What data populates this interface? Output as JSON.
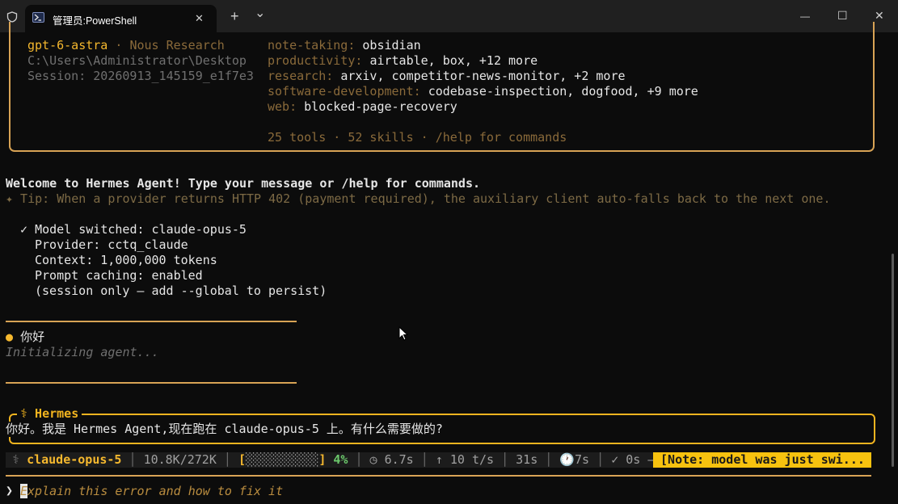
{
  "window": {
    "tab_title": "管理员:PowerShell",
    "tab_close": "✕",
    "new_tab": "+",
    "dropdown": "⌄",
    "minimize": "—",
    "maximize": "☐",
    "close": "✕"
  },
  "banner": {
    "model": "gpt-6-astra",
    "model_sep": " · ",
    "provider": "Nous Research",
    "cwd": "C:\\Users\\Administrator\\Desktop",
    "session": "Session: 20260913_145159_e1f7e3",
    "skills": [
      {
        "category": "note-taking:",
        "value": "obsidian"
      },
      {
        "category": "productivity:",
        "value": "airtable, box, +12 more"
      },
      {
        "category": "research:",
        "value": "arxiv, competitor-news-monitor, +2 more"
      },
      {
        "category": "software-development:",
        "value": "codebase-inspection, dogfood, +9 more"
      },
      {
        "category": "web:",
        "value": "blocked-page-recovery"
      }
    ],
    "summary": "25 tools · 52 skills · /help for commands"
  },
  "welcome": "Welcome to Hermes Agent! Type your message or /help for commands.",
  "tip": "✦ Tip: When a provider returns HTTP 402 (payment required), the auxiliary client auto-falls back to the next one.",
  "model_switch": {
    "check": "✓",
    "lines": [
      "Model switched: claude-opus-5",
      "Provider: cctq_claude",
      "Context: 1,000,000 tokens",
      "Prompt caching: enabled",
      "(session only — add --global to persist)"
    ]
  },
  "user_message": {
    "bullet": "●",
    "text": "你好",
    "status": "Initializing agent..."
  },
  "hermes": {
    "title": "⚕ Hermes",
    "reply": "你好。我是 Hermes Agent,现在跑在 claude-opus-5 上。有什么需要做的?"
  },
  "statusbar": {
    "icon": "⚕",
    "model": "claude-opus-5",
    "tokens": "10.8K/272K",
    "ctx_bar_open": "[",
    "ctx_bar_fill": "░░░░░░░░░░",
    "ctx_bar_close": "]",
    "ctx_pct": "4%",
    "latency": "◷ 6.7s",
    "speed": "↑ 10 t/s",
    "elapsed": "31s",
    "tool_time": "🕐7s",
    "check_time": "✓ 0s",
    "dash": "—",
    "note": "[Note: model was just swi..."
  },
  "prompt": {
    "symbol": "❯",
    "placeholder": "Explain this error and how to fix it"
  },
  "colors": {
    "accent": "#f5b82e",
    "border": "#d8a355",
    "note_bg": "#f7c20f"
  }
}
